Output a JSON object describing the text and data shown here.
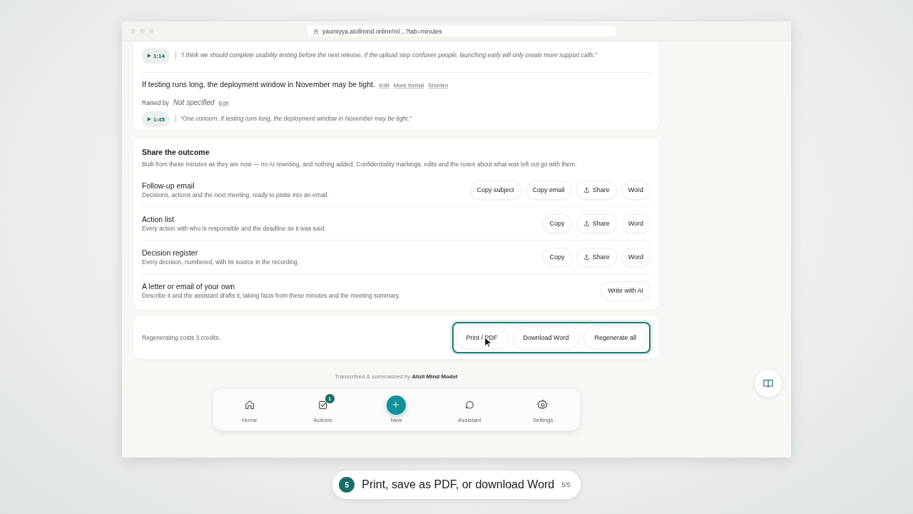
{
  "browser": {
    "url": "yaumiyya.atollmind.online/m/...?tab=minutes"
  },
  "minutes_card": {
    "top_quote": {
      "time": "1:14",
      "text": "“I think we should complete usability testing before the next release. If the upload step confuses people, launching early will only create more support calls.”"
    },
    "point": {
      "text": "If testing runs long, the deployment window in November may be tight.",
      "links": [
        "Edit",
        "More formal",
        "Shorten"
      ],
      "raised_by_label": "Raised by",
      "raised_by": "Not specified",
      "raised_by_link": "Edit",
      "quote": {
        "time": "1:45",
        "text": "“One concern. If testing runs long, the deployment window in November may be tight.”"
      }
    }
  },
  "share": {
    "title": "Share the outcome",
    "description": "Built from these minutes as they are now — no AI rewriting, and nothing added. Confidentiality markings, edits and the notes about what was left out go with them.",
    "rows": [
      {
        "title": "Follow-up email",
        "description": "Decisions, actions and the next meeting, ready to paste into an email.",
        "buttons": [
          {
            "kind": "plain",
            "label": "Copy subject"
          },
          {
            "kind": "plain",
            "label": "Copy email"
          },
          {
            "kind": "share",
            "label": "Share"
          },
          {
            "kind": "plain",
            "label": "Word"
          }
        ]
      },
      {
        "title": "Action list",
        "description": "Every action with who is responsible and the deadline as it was said.",
        "buttons": [
          {
            "kind": "plain",
            "label": "Copy"
          },
          {
            "kind": "share",
            "label": "Share"
          },
          {
            "kind": "plain",
            "label": "Word"
          }
        ]
      },
      {
        "title": "Decision register",
        "description": "Every decision, numbered, with its source in the recording.",
        "buttons": [
          {
            "kind": "plain",
            "label": "Copy"
          },
          {
            "kind": "share",
            "label": "Share"
          },
          {
            "kind": "plain",
            "label": "Word"
          }
        ]
      },
      {
        "title": "A letter or email of your own",
        "description": "Describe it and the assistant drafts it, taking facts from these minutes and the meeting summary.",
        "buttons": [
          {
            "kind": "plain",
            "label": "Write with AI"
          }
        ]
      }
    ]
  },
  "footer_actions": {
    "note": "Regenerating costs 3 credits.",
    "highlighted": true,
    "buttons": [
      "Print / PDF",
      "Download Word",
      "Regenerate all"
    ]
  },
  "credit": "Transcribed & summarized by **Atoll Mind Model**",
  "nav": {
    "items": [
      {
        "kind": "home",
        "label": "Home"
      },
      {
        "kind": "actions",
        "label": "Actions",
        "badge": "1"
      },
      {
        "kind": "new",
        "label": "New"
      },
      {
        "kind": "assistant",
        "label": "Assistant"
      },
      {
        "kind": "settings",
        "label": "Settings"
      }
    ]
  },
  "caption": {
    "step": "5",
    "text": "Print, save as PDF, or download Word",
    "progress": "5/5"
  }
}
